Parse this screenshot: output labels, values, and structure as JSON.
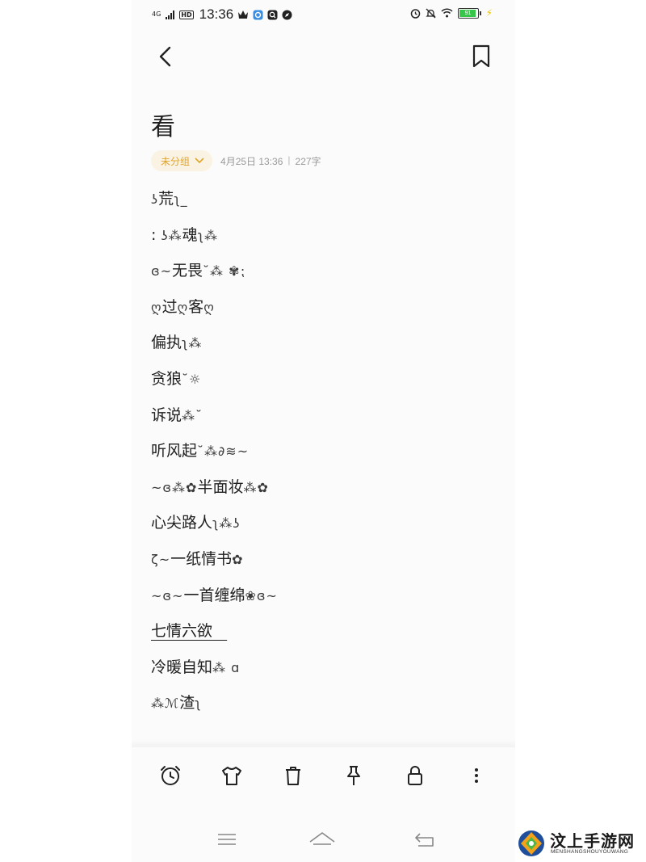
{
  "status_bar": {
    "network": "4G",
    "hd": "HD",
    "time": "13:36",
    "battery_level": "91"
  },
  "note": {
    "title": "看",
    "group": "未分组",
    "date": "4月25日 13:36",
    "separator": "|",
    "char_count": "227字",
    "lines": [
      {
        "pre": "",
        "text": "荒",
        "post": ""
      },
      {
        "pre": ":",
        "text": "魂",
        "post": ""
      },
      {
        "pre": "",
        "text": "无畏",
        "post": ""
      },
      {
        "pre": "",
        "text": "过",
        "mid": "客",
        "post": ""
      },
      {
        "pre": "",
        "text": "偏执",
        "post": ""
      },
      {
        "pre": "",
        "text": "贪狼",
        "post": ""
      },
      {
        "pre": "",
        "text": "诉说",
        "post": ""
      },
      {
        "pre": "",
        "text": "听风起",
        "post": ""
      },
      {
        "pre": "",
        "text": "半面妆",
        "post": ""
      },
      {
        "pre": "",
        "text": "心尖路人",
        "post": ""
      },
      {
        "pre": "",
        "text": "一纸情书",
        "post": ""
      },
      {
        "pre": "",
        "text": "一首缠绵",
        "post": ""
      },
      {
        "pre": "",
        "text": "七情六欲",
        "post": ""
      },
      {
        "pre": "",
        "text": "冷暖自知",
        "post": ""
      },
      {
        "pre": "",
        "text": "渣",
        "post": ""
      }
    ]
  },
  "watermark": {
    "main": "汶上手游网",
    "sub": "MENSHANGSHOUYOUWANG"
  },
  "colors": {
    "accent": "#e0a42a",
    "chip_bg": "#faf3e4",
    "battery": "#37c64a"
  }
}
